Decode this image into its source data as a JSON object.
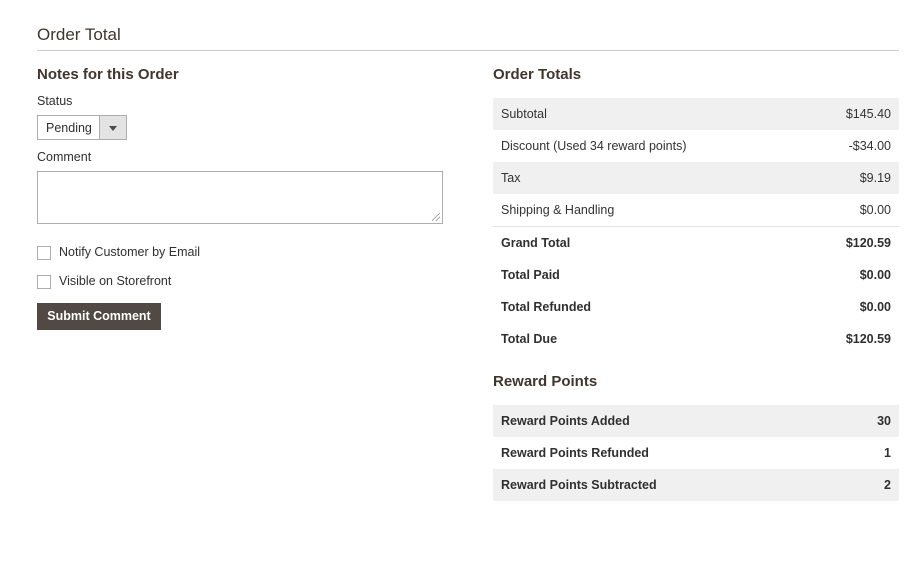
{
  "section": {
    "title": "Order Total"
  },
  "notes": {
    "title": "Notes for this Order",
    "status_label": "Status",
    "status_value": "Pending",
    "comment_label": "Comment",
    "comment_value": "",
    "notify_label": "Notify Customer by Email",
    "visible_label": "Visible on Storefront",
    "submit_label": "Submit Comment"
  },
  "order_totals": {
    "title": "Order Totals",
    "rows": [
      {
        "label": "Subtotal",
        "value": "$145.40"
      },
      {
        "label": "Discount (Used 34 reward points)",
        "value": "-$34.00"
      },
      {
        "label": "Tax",
        "value": "$9.19"
      },
      {
        "label": "Shipping & Handling",
        "value": "$0.00"
      },
      {
        "label": "Grand Total",
        "value": "$120.59"
      },
      {
        "label": "Total Paid",
        "value": "$0.00"
      },
      {
        "label": "Total Refunded",
        "value": "$0.00"
      },
      {
        "label": "Total Due",
        "value": "$120.59"
      }
    ]
  },
  "reward_points": {
    "title": "Reward Points",
    "rows": [
      {
        "label": "Reward Points Added",
        "value": "30"
      },
      {
        "label": "Reward Points Refunded",
        "value": "1"
      },
      {
        "label": "Reward Points Subtracted",
        "value": "2"
      }
    ]
  },
  "colors": {
    "button": "#514943",
    "row_alt": "#f0f0f0",
    "heading": "#41362f"
  }
}
